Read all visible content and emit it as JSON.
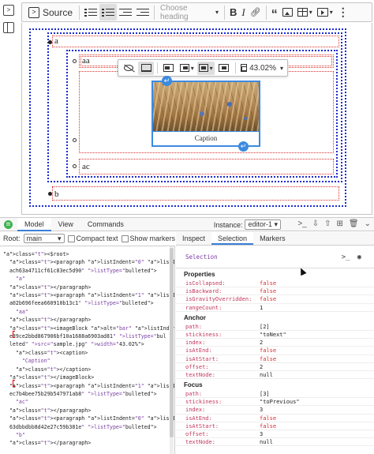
{
  "toolbar": {
    "source_label": "Source",
    "heading_placeholder": "Choose heading"
  },
  "editor": {
    "items": {
      "a": "a",
      "aa": "aa",
      "ac": "ac",
      "b": "b"
    },
    "image_toolbar": {
      "resize_value": "43.02%"
    },
    "caption": "Caption"
  },
  "inspector": {
    "tabs": [
      "Model",
      "View",
      "Commands"
    ],
    "instance_label": "Instance:",
    "instance_value": "editor-1",
    "root_label": "Root:",
    "root_value": "main",
    "compact_text": "Compact text",
    "show_markers": "Show markers",
    "side_tabs": [
      "Inspect",
      "Selection",
      "Markers"
    ],
    "model_lines": [
      "<$root>",
      "  <paragraph listIndent=\"0\" listItemId=\"e189b1f813",
      "  ach63a4711cf61c83ec5d90\" listType=\"bulleted\">",
      "    \"a\"",
      "  </paragraph>",
      "  <paragraph listIndent=\"1\" listItemId=\"eb17b0d3e1",
      "  a02b696feea660910b13c1\" listType=\"bulleted\">",
      "    \"aa\"",
      "  </paragraph>",
      "  <imageBlock alt=\"bar\" listIndent=\"1\" listItemId=\"",
      "  e39ce2bbd867906bf10a1688a6903ad81\" listType=\"bul",
      "  leted\" src=\"sample.jpg\" width=\"43.02%\">",
      "    <caption>",
      "      \"Caption\"",
      "    </caption>",
      "  </imageBlock>",
      "  <paragraph listIndent=\"1\" listItemId=\"ec73f0ce88",
      "  ec7b4bee75b29b547971ab8\" listType=\"bulleted\">",
      "    \"ac\"",
      "  </paragraph>",
      "  <paragraph listIndent=\"0\" listItemId=\"e5d469ea0d",
      "  63dbbdbb8d42e27c59b381e\" listType=\"bulleted\">",
      "    \"b\"",
      "  </paragraph>"
    ],
    "selection_title": "Selection",
    "properties_title": "Properties",
    "properties": [
      {
        "k": "isCollapsed:",
        "v": "false"
      },
      {
        "k": "isBackward:",
        "v": "false"
      },
      {
        "k": "isGravityOverridden:",
        "v": "false"
      },
      {
        "k": "rangeCount:",
        "v": "1"
      }
    ],
    "anchor_title": "Anchor",
    "anchor": [
      {
        "k": "path:",
        "v": "[2]"
      },
      {
        "k": "stickiness:",
        "v": "\"toNext\""
      },
      {
        "k": "index:",
        "v": "2"
      },
      {
        "k": "isAtEnd:",
        "v": "false"
      },
      {
        "k": "isAtStart:",
        "v": "false"
      },
      {
        "k": "offset:",
        "v": "2"
      },
      {
        "k": "textNode:",
        "v": "null"
      }
    ],
    "focus_title": "Focus",
    "focus": [
      {
        "k": "path:",
        "v": "[3]"
      },
      {
        "k": "stickiness:",
        "v": "\"toPrevious\""
      },
      {
        "k": "index:",
        "v": "3"
      },
      {
        "k": "isAtEnd:",
        "v": "false"
      },
      {
        "k": "isAtStart:",
        "v": "false"
      },
      {
        "k": "offset:",
        "v": "3"
      },
      {
        "k": "textNode:",
        "v": "null"
      }
    ]
  }
}
